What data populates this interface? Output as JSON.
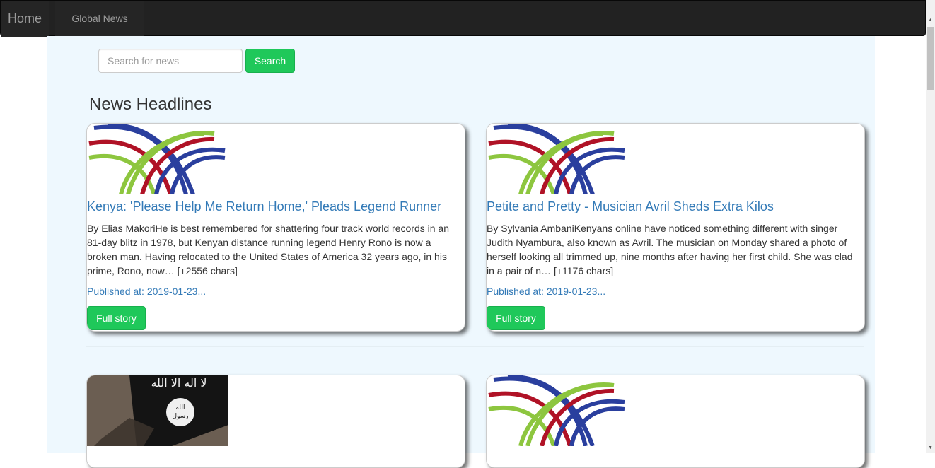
{
  "navbar": {
    "brand": "Home",
    "link": "Global News"
  },
  "search": {
    "placeholder": "Search for news",
    "button": "Search"
  },
  "page": {
    "title": "News Headlines"
  },
  "articles": [
    {
      "title": "Kenya: 'Please Help Me Return Home,' Pleads Legend Runner",
      "description": "By Elias MakoriHe is best remembered for shattering four track world records in an 81-day blitz in 1978, but Kenyan distance running legend Henry Rono is now a broken man. Having relocated to the United States of America 32 years ago, in his prime, Rono, now… [+2556 chars]",
      "published": "Published at: 2019-01-23...",
      "button": "Full story",
      "image": "tricolor-arches-logo"
    },
    {
      "title": "Petite and Pretty - Musician Avril Sheds Extra Kilos",
      "description": "By Sylvania AmbaniKenyans online have noticed something different with singer Judith Nyambura, also known as Avril. The musician on Monday shared a photo of herself looking all trimmed up, nine months after having her first child. She was clad in a pair of n… [+1176 chars]",
      "published": "Published at: 2019-01-23...",
      "button": "Full story",
      "image": "tricolor-arches-logo"
    },
    {
      "image": "black-flag-photo"
    },
    {
      "image": "tricolor-arches-logo"
    }
  ],
  "colors": {
    "navbar": "#222222",
    "content_bg": "#eef8fe",
    "button_green": "#1fc85a",
    "link_blue": "#337ab7",
    "logo_blue": "#2a3f9e",
    "logo_red": "#b01226",
    "logo_green": "#8dc63f"
  },
  "icons": {
    "scroll_up": "triangle-up-icon",
    "scroll_down": "triangle-down-icon"
  }
}
